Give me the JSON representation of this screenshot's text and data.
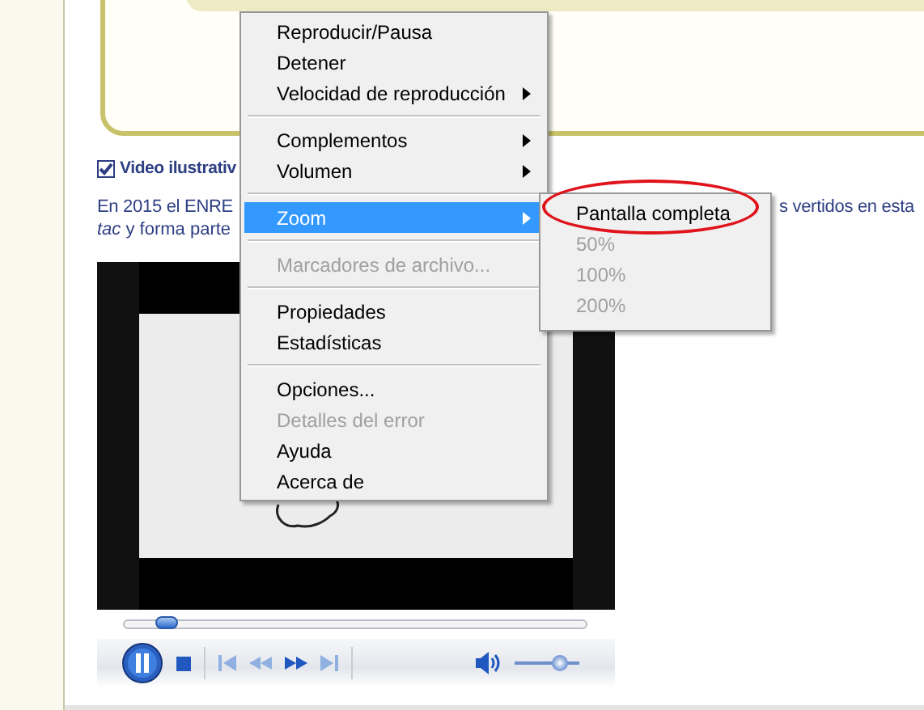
{
  "page": {
    "heading": "Video ilustrativ",
    "paragraph_line_1_left": "En 2015 el ENRE",
    "paragraph_line_1_right": "s vertidos en esta",
    "paragraph_line_2": "*tac* y forma parte"
  },
  "player": {
    "seek": {
      "level": 0.09
    },
    "volume": {
      "level": 0.7
    },
    "playing": true
  },
  "context_menu": {
    "items": [
      {
        "kind": "item",
        "label": "Reproducir/Pausa",
        "disabled": false,
        "submenu": false,
        "selected": false
      },
      {
        "kind": "item",
        "label": "Detener",
        "disabled": false,
        "submenu": false,
        "selected": false
      },
      {
        "kind": "item",
        "label": "Velocidad de reproducción",
        "disabled": false,
        "submenu": true,
        "selected": false
      },
      {
        "kind": "separator"
      },
      {
        "kind": "item",
        "label": "Complementos",
        "disabled": false,
        "submenu": true,
        "selected": false
      },
      {
        "kind": "item",
        "label": "Volumen",
        "disabled": false,
        "submenu": true,
        "selected": false
      },
      {
        "kind": "separator"
      },
      {
        "kind": "item",
        "label": "Zoom",
        "disabled": false,
        "submenu": true,
        "selected": true
      },
      {
        "kind": "separator"
      },
      {
        "kind": "item",
        "label": "Marcadores de archivo...",
        "disabled": true,
        "submenu": false,
        "selected": false
      },
      {
        "kind": "separator"
      },
      {
        "kind": "item",
        "label": "Propiedades",
        "disabled": false,
        "submenu": false,
        "selected": false
      },
      {
        "kind": "item",
        "label": "Estadísticas",
        "disabled": false,
        "submenu": false,
        "selected": false
      },
      {
        "kind": "separator"
      },
      {
        "kind": "item",
        "label": "Opciones...",
        "disabled": false,
        "submenu": false,
        "selected": false
      },
      {
        "kind": "item",
        "label": "Detalles del error",
        "disabled": true,
        "submenu": false,
        "selected": false
      },
      {
        "kind": "item",
        "label": "Ayuda",
        "disabled": false,
        "submenu": false,
        "selected": false
      },
      {
        "kind": "item",
        "label": "Acerca de",
        "disabled": false,
        "submenu": false,
        "selected": false
      }
    ]
  },
  "zoom_submenu": {
    "items": [
      {
        "label": "Pantalla completa",
        "disabled": false,
        "circled": true
      },
      {
        "label": "50%",
        "disabled": true,
        "circled": false
      },
      {
        "label": "100%",
        "disabled": true,
        "circled": false
      },
      {
        "label": "200%",
        "disabled": true,
        "circled": false
      }
    ]
  }
}
